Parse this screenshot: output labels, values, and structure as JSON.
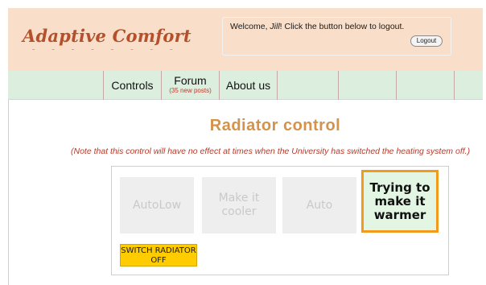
{
  "app": {
    "logo_text": "Adaptive Comfort",
    "logo_dashes": "- - - - - - - - - -"
  },
  "account": {
    "welcome_prefix": "Welcome, ",
    "user_name": "Jill",
    "welcome_suffix": "! Click the button below to logout.",
    "logout_label": "Logout"
  },
  "nav": {
    "items": [
      {
        "label": "Controls",
        "sub": ""
      },
      {
        "label": "Forum",
        "sub": "(35 new posts)"
      },
      {
        "label": "About us",
        "sub": ""
      }
    ]
  },
  "page": {
    "title": "Radiator control",
    "note": "(Note that this control will have no effect at times when the University has switched the heating system off.)"
  },
  "controls": {
    "modes": [
      {
        "label": "AutoLow"
      },
      {
        "label": "Make it cooler"
      },
      {
        "label": "Auto"
      },
      {
        "label": "Trying to make it warmer"
      }
    ],
    "switch_off_label": "SWITCH RADIATOR OFF"
  },
  "colors": {
    "header_bg": "#f9dfc9",
    "nav_bg": "#dcefdf",
    "logo": "#b5502c",
    "title": "#d4924a",
    "note": "#b53a2a",
    "active_border": "#f29a1b",
    "switch_bg": "#ffcc00"
  }
}
